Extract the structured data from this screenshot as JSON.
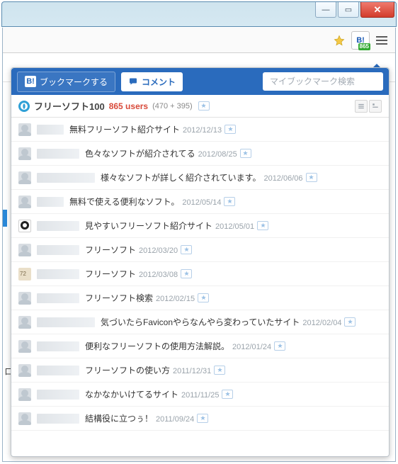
{
  "window": {
    "minimize_glyph": "—",
    "maximize_glyph": "▭",
    "close_glyph": "✕"
  },
  "extension": {
    "badge_text": "B!",
    "count_badge": "865"
  },
  "popup_header": {
    "bookmark_button_b": "B!",
    "bookmark_button_label": "ブックマークする",
    "comment_button_label": "コメント",
    "search_placeholder": "マイブックマーク検索"
  },
  "site_bar": {
    "site_name": "フリーソフト100",
    "users_text": "865 users",
    "users_breakdown": "(470 + 395)"
  },
  "comments": [
    {
      "text": "無料フリーソフト紹介サイト",
      "date": "2012/12/13",
      "avatar": "default",
      "indent": 0
    },
    {
      "text": "色々なソフトが紹介されてる",
      "date": "2012/08/25",
      "avatar": "default",
      "indent": 1
    },
    {
      "text": "様々なソフトが詳しく紹介されています。",
      "date": "2012/06/06",
      "avatar": "default",
      "indent": 2
    },
    {
      "text": "無料で使える便利なソフト。",
      "date": "2012/05/14",
      "avatar": "default",
      "indent": 0
    },
    {
      "text": "見やすいフリーソフト紹介サイト",
      "date": "2012/05/01",
      "avatar": "user1",
      "indent": 1
    },
    {
      "text": "フリーソフト",
      "date": "2012/03/20",
      "avatar": "default",
      "indent": 1
    },
    {
      "text": "フリーソフト",
      "date": "2012/03/08",
      "avatar": "user2",
      "indent": 1
    },
    {
      "text": "フリーソフト検索",
      "date": "2012/02/15",
      "avatar": "default",
      "indent": 1
    },
    {
      "text": "気づいたらFaviconやらなんやら変わっていたサイト",
      "date": "2012/02/04",
      "avatar": "default",
      "indent": 2
    },
    {
      "text": "便利なフリーソフトの使用方法解説。",
      "date": "2012/01/24",
      "avatar": "default",
      "indent": 1
    },
    {
      "text": "フリーソフトの使い方",
      "date": "2011/12/31",
      "avatar": "default",
      "indent": 1
    },
    {
      "text": "なかなかいけてるサイト",
      "date": "2011/11/25",
      "avatar": "default",
      "indent": 1
    },
    {
      "text": "結構役に立つぅ！",
      "date": "2011/09/24",
      "avatar": "default",
      "indent": 1
    }
  ],
  "behind": {
    "side_char": "ロ"
  }
}
